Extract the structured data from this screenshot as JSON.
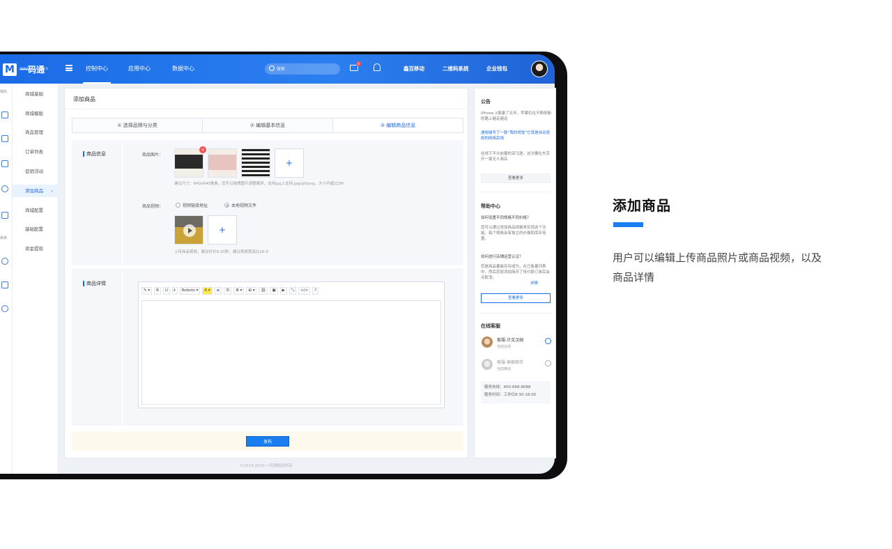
{
  "nav": {
    "logo_text": "一码通",
    "logo_sub": "WWW.YIMATONG.CN",
    "tabs": [
      "控制中心",
      "应用中心",
      "数据中心"
    ],
    "search_placeholder": "搜索",
    "mail_badge": "9",
    "links": [
      "鑫百移动",
      "二维码系统",
      "企业钱包"
    ]
  },
  "icon_rail": {
    "top_text": "我的",
    "bottom_text": "系统"
  },
  "subnav": {
    "items": [
      "商城基础",
      "商城模版",
      "商品管理",
      "订单列表",
      "促销活动",
      "添加商品",
      "商城配置",
      "基础配置",
      "资金提现"
    ],
    "active_index": 5
  },
  "main": {
    "title": "添加商品",
    "steps": [
      "① 选择品牌与分类",
      "② 编辑基本信息",
      "③ 编辑商品信息"
    ],
    "info_section": {
      "label": "商品信息",
      "images_label": "商品图片：",
      "images_hint": "建议尺寸：640x640像素，您可以拖拽图片调整顺序，支持jpg上支持.jpg/gif/png，大小不超过2M",
      "video_label": "商品视频：",
      "video_options": [
        "视频链接地址",
        "本地视频文件"
      ],
      "video_selected_index": 1,
      "video_hint": "上传商品视频，建议时长9-30秒，建议视频宽高比16:9"
    },
    "detail_section": {
      "label": "商品详情",
      "toolbar": [
        "✎ ▾",
        "B",
        "U",
        "I̶",
        "Roboto ▾",
        "A ▾",
        "≡",
        "☰",
        "≣ ▾",
        "⊞ ▾",
        "⛓",
        "▣",
        "▶",
        "⤡",
        "</>",
        "?"
      ]
    },
    "publish_label": "发布",
    "footer": "©2019-2020 一码通版权所有"
  },
  "right_panel": {
    "notice_title": "公告",
    "notice_text": "iPhone X客量了五年，苹果仍在不断刷新的路上越走越远",
    "notice_link": "遇用描写了一款“我的视觉”它就是自动发射的网络后场",
    "notice_text2": "在线下不计前量的亚马逊，这次要在东京开一家无人商店",
    "notice_more": "查看更多",
    "help_title": "帮助中心",
    "help_q1": "如何设置不同规格不同价格？",
    "help_a1": "您可以通过添加商品规格来实现这个功能，每个规格会有独立的价格和库存设置。",
    "help_q2": "如何进行店铺运营认证？",
    "help_a2": "您是商品量最存存成为，在已售量列表中，然后您就添加商存了待付款订单后会点取消。",
    "help_link": "详情",
    "help_more": "查看更多",
    "service_title": "在线客服",
    "services": [
      {
        "name": "客服-贝克汉姆",
        "status": "当前在线"
      },
      {
        "name": "客服-索娜丽莎",
        "status": "当前离线"
      }
    ],
    "contact_phone": "服务热线：400-668-8088",
    "contact_time": "服务时间：工作日8:30-18:00"
  },
  "description": {
    "title": "添加商品",
    "text": "用户可以编辑上传商品照片或商品视频，以及商品详情",
    "accent": "#1a7df0"
  }
}
